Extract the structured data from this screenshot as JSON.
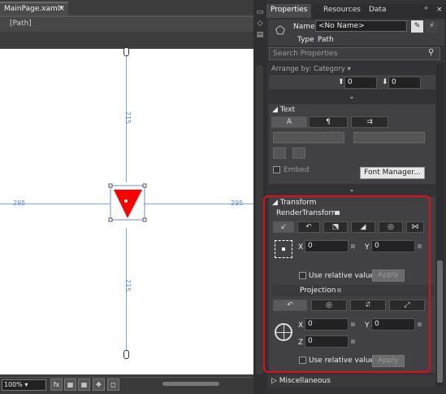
{
  "document": {
    "tab_label": "MainPage.xaml*",
    "close_glyph": "×",
    "breadcrumb": "[Path]"
  },
  "artboard": {
    "dim_top": "215",
    "dim_bottom": "215",
    "dim_left": "295",
    "dim_right": "295",
    "shape_color": "#ff0000"
  },
  "status": {
    "zoom": "100%",
    "buttons": [
      "fx",
      "▦",
      "▦",
      "✥",
      "◻"
    ]
  },
  "panel": {
    "tabs": [
      "Properties",
      "Resources",
      "Data"
    ],
    "pin": "ᵖ",
    "close": "×",
    "name_label": "Name",
    "name_value": "<No Name>",
    "type_label": "Type",
    "type_value": "Path",
    "search_placeholder": "Search Properties",
    "arrange_by": "Arrange by: Category ▾",
    "layout_fields": [
      "0",
      "0"
    ],
    "text_section": {
      "title": "Text",
      "tabs": [
        "A",
        "¶",
        "⇉"
      ],
      "embed": "Embed",
      "font_manager": "Font Manager..."
    },
    "transform_section": {
      "title": "Transform",
      "render_transform": "RenderTransform",
      "rt_tabs": [
        "↙",
        "↶",
        "⬔",
        "◢",
        "◎",
        "⋈"
      ],
      "x_label": "X",
      "x_value": "0",
      "y_label": "Y",
      "y_value": "0",
      "use_relative": "Use relative values",
      "apply": "Apply",
      "projection": "Projection",
      "proj_tabs": [
        "↶",
        "◎",
        "⮃",
        "⤢"
      ],
      "px_value": "0",
      "py_value": "0",
      "z_label": "Z",
      "pz_value": "0",
      "use_relative2": "Use relative values",
      "apply2": "Apply"
    },
    "misc": "Miscellaneous"
  },
  "colors": {
    "accent_red": "#e0101a",
    "guide_blue": "#7aa6ff"
  }
}
